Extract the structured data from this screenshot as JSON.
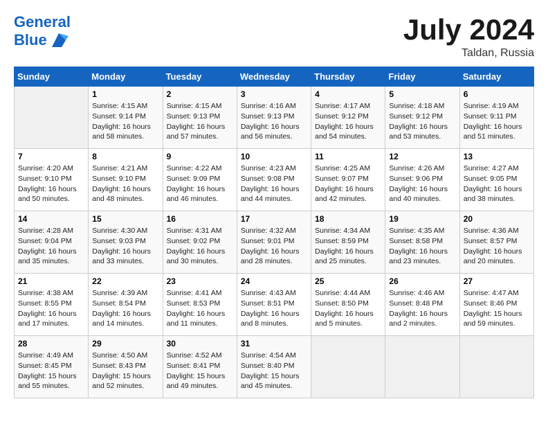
{
  "header": {
    "logo_line1": "General",
    "logo_line2": "Blue",
    "month": "July 2024",
    "location": "Taldan, Russia"
  },
  "calendar": {
    "days_of_week": [
      "Sunday",
      "Monday",
      "Tuesday",
      "Wednesday",
      "Thursday",
      "Friday",
      "Saturday"
    ],
    "weeks": [
      [
        {
          "num": "",
          "info": ""
        },
        {
          "num": "1",
          "info": "Sunrise: 4:15 AM\nSunset: 9:14 PM\nDaylight: 16 hours\nand 58 minutes."
        },
        {
          "num": "2",
          "info": "Sunrise: 4:15 AM\nSunset: 9:13 PM\nDaylight: 16 hours\nand 57 minutes."
        },
        {
          "num": "3",
          "info": "Sunrise: 4:16 AM\nSunset: 9:13 PM\nDaylight: 16 hours\nand 56 minutes."
        },
        {
          "num": "4",
          "info": "Sunrise: 4:17 AM\nSunset: 9:12 PM\nDaylight: 16 hours\nand 54 minutes."
        },
        {
          "num": "5",
          "info": "Sunrise: 4:18 AM\nSunset: 9:12 PM\nDaylight: 16 hours\nand 53 minutes."
        },
        {
          "num": "6",
          "info": "Sunrise: 4:19 AM\nSunset: 9:11 PM\nDaylight: 16 hours\nand 51 minutes."
        }
      ],
      [
        {
          "num": "7",
          "info": "Sunrise: 4:20 AM\nSunset: 9:10 PM\nDaylight: 16 hours\nand 50 minutes."
        },
        {
          "num": "8",
          "info": "Sunrise: 4:21 AM\nSunset: 9:10 PM\nDaylight: 16 hours\nand 48 minutes."
        },
        {
          "num": "9",
          "info": "Sunrise: 4:22 AM\nSunset: 9:09 PM\nDaylight: 16 hours\nand 46 minutes."
        },
        {
          "num": "10",
          "info": "Sunrise: 4:23 AM\nSunset: 9:08 PM\nDaylight: 16 hours\nand 44 minutes."
        },
        {
          "num": "11",
          "info": "Sunrise: 4:25 AM\nSunset: 9:07 PM\nDaylight: 16 hours\nand 42 minutes."
        },
        {
          "num": "12",
          "info": "Sunrise: 4:26 AM\nSunset: 9:06 PM\nDaylight: 16 hours\nand 40 minutes."
        },
        {
          "num": "13",
          "info": "Sunrise: 4:27 AM\nSunset: 9:05 PM\nDaylight: 16 hours\nand 38 minutes."
        }
      ],
      [
        {
          "num": "14",
          "info": "Sunrise: 4:28 AM\nSunset: 9:04 PM\nDaylight: 16 hours\nand 35 minutes."
        },
        {
          "num": "15",
          "info": "Sunrise: 4:30 AM\nSunset: 9:03 PM\nDaylight: 16 hours\nand 33 minutes."
        },
        {
          "num": "16",
          "info": "Sunrise: 4:31 AM\nSunset: 9:02 PM\nDaylight: 16 hours\nand 30 minutes."
        },
        {
          "num": "17",
          "info": "Sunrise: 4:32 AM\nSunset: 9:01 PM\nDaylight: 16 hours\nand 28 minutes."
        },
        {
          "num": "18",
          "info": "Sunrise: 4:34 AM\nSunset: 8:59 PM\nDaylight: 16 hours\nand 25 minutes."
        },
        {
          "num": "19",
          "info": "Sunrise: 4:35 AM\nSunset: 8:58 PM\nDaylight: 16 hours\nand 23 minutes."
        },
        {
          "num": "20",
          "info": "Sunrise: 4:36 AM\nSunset: 8:57 PM\nDaylight: 16 hours\nand 20 minutes."
        }
      ],
      [
        {
          "num": "21",
          "info": "Sunrise: 4:38 AM\nSunset: 8:55 PM\nDaylight: 16 hours\nand 17 minutes."
        },
        {
          "num": "22",
          "info": "Sunrise: 4:39 AM\nSunset: 8:54 PM\nDaylight: 16 hours\nand 14 minutes."
        },
        {
          "num": "23",
          "info": "Sunrise: 4:41 AM\nSunset: 8:53 PM\nDaylight: 16 hours\nand 11 minutes."
        },
        {
          "num": "24",
          "info": "Sunrise: 4:43 AM\nSunset: 8:51 PM\nDaylight: 16 hours\nand 8 minutes."
        },
        {
          "num": "25",
          "info": "Sunrise: 4:44 AM\nSunset: 8:50 PM\nDaylight: 16 hours\nand 5 minutes."
        },
        {
          "num": "26",
          "info": "Sunrise: 4:46 AM\nSunset: 8:48 PM\nDaylight: 16 hours\nand 2 minutes."
        },
        {
          "num": "27",
          "info": "Sunrise: 4:47 AM\nSunset: 8:46 PM\nDaylight: 15 hours\nand 59 minutes."
        }
      ],
      [
        {
          "num": "28",
          "info": "Sunrise: 4:49 AM\nSunset: 8:45 PM\nDaylight: 15 hours\nand 55 minutes."
        },
        {
          "num": "29",
          "info": "Sunrise: 4:50 AM\nSunset: 8:43 PM\nDaylight: 15 hours\nand 52 minutes."
        },
        {
          "num": "30",
          "info": "Sunrise: 4:52 AM\nSunset: 8:41 PM\nDaylight: 15 hours\nand 49 minutes."
        },
        {
          "num": "31",
          "info": "Sunrise: 4:54 AM\nSunset: 8:40 PM\nDaylight: 15 hours\nand 45 minutes."
        },
        {
          "num": "",
          "info": ""
        },
        {
          "num": "",
          "info": ""
        },
        {
          "num": "",
          "info": ""
        }
      ]
    ]
  }
}
